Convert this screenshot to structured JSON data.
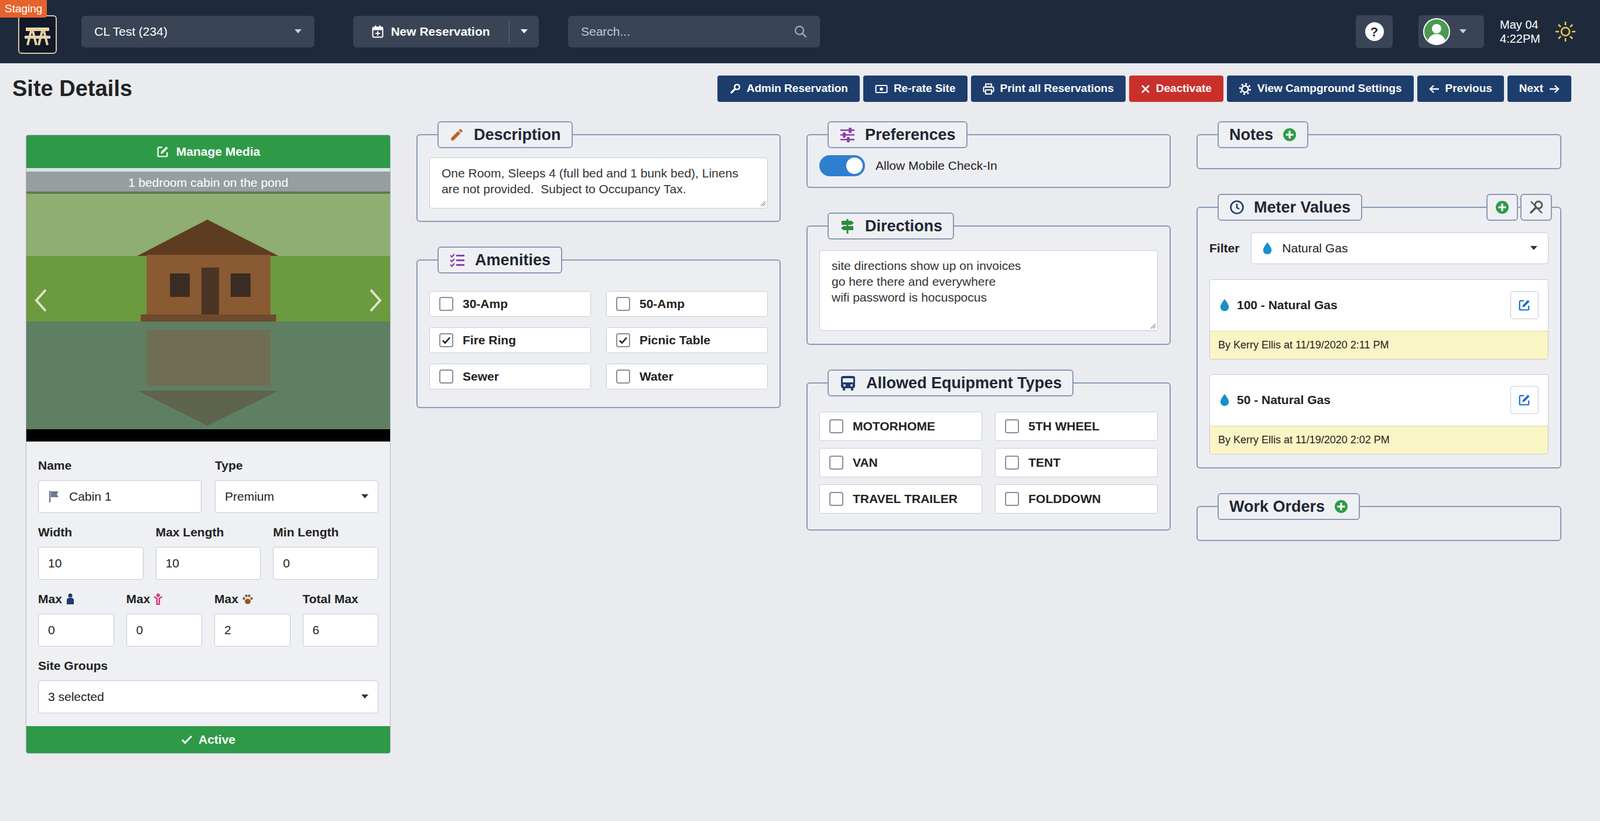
{
  "environment": "Staging",
  "topbar": {
    "campground": "CL Test (234)",
    "new_reservation": "New Reservation",
    "search": {
      "placeholder": "Search..."
    },
    "help": "?",
    "date": "May 04",
    "time": "4:22PM"
  },
  "page": {
    "title": "Site Details"
  },
  "actions": [
    {
      "label": "Admin Reservation",
      "kind": "primary"
    },
    {
      "label": "Re-rate Site",
      "kind": "primary"
    },
    {
      "label": "Print all Reservations",
      "kind": "primary"
    },
    {
      "label": "Deactivate",
      "kind": "danger"
    },
    {
      "label": "View Campground Settings",
      "kind": "primary"
    },
    {
      "label": "Previous",
      "kind": "primary"
    },
    {
      "label": "Next",
      "kind": "primary"
    }
  ],
  "media": {
    "header": "Manage Media",
    "caption": "1 bedroom cabin on the pond"
  },
  "site_form": {
    "name": {
      "label": "Name",
      "value": "Cabin 1",
      "kind": "text"
    },
    "type": {
      "label": "Type",
      "value": "Premium",
      "kind": "select"
    },
    "width": {
      "label": "Width",
      "value": "10",
      "kind": "text"
    },
    "max_length": {
      "label": "Max Length",
      "value": "10",
      "kind": "text"
    },
    "min_length": {
      "label": "Min Length",
      "value": "0",
      "kind": "text"
    },
    "max_adults": {
      "label": "Max",
      "value": "0",
      "kind": "text"
    },
    "max_children": {
      "label": "Max",
      "value": "0",
      "kind": "text"
    },
    "max_pets": {
      "label": "Max",
      "value": "2",
      "kind": "text"
    },
    "total_max": {
      "label": "Total Max",
      "value": "6",
      "kind": "text"
    },
    "site_groups": {
      "label": "Site Groups",
      "value": "3 selected",
      "kind": "select"
    }
  },
  "status": {
    "label": "Active",
    "active": true
  },
  "description": {
    "title": "Description",
    "text": "One Room, Sleeps 4 (full bed and 1 bunk bed), Linens are not provided.  Subject to Occupancy Tax."
  },
  "amenities": {
    "title": "Amenities",
    "items": [
      {
        "label": "30-Amp",
        "checked": false
      },
      {
        "label": "50-Amp",
        "checked": false
      },
      {
        "label": "Fire Ring",
        "checked": true
      },
      {
        "label": "Picnic Table",
        "checked": true
      },
      {
        "label": "Sewer",
        "checked": false
      },
      {
        "label": "Water",
        "checked": false
      }
    ]
  },
  "preferences": {
    "title": "Preferences",
    "items": [
      {
        "label": "Allow Mobile Check-In",
        "on": true
      }
    ]
  },
  "directions": {
    "title": "Directions",
    "text": "site directions show up on invoices\ngo here there and everywhere\nwifi password is hocuspocus"
  },
  "equipment": {
    "title": "Allowed Equipment Types",
    "items": [
      {
        "label": "MOTORHOME",
        "checked": false
      },
      {
        "label": "5TH WHEEL",
        "checked": false
      },
      {
        "label": "VAN",
        "checked": false
      },
      {
        "label": "TENT",
        "checked": false
      },
      {
        "label": "TRAVEL TRAILER",
        "checked": false
      },
      {
        "label": "FOLDDOWN",
        "checked": false
      }
    ]
  },
  "notes": {
    "title": "Notes"
  },
  "meters": {
    "title": "Meter Values",
    "filter": {
      "label": "Filter",
      "value": "Natural Gas"
    },
    "entries": [
      {
        "value": "100 - Natural Gas",
        "by": "By Kerry Ellis at 11/19/2020 2:11 PM"
      },
      {
        "value": "50 - Natural Gas",
        "by": "By Kerry Ellis at 11/19/2020 2:02 PM"
      }
    ]
  },
  "work_orders": {
    "title": "Work Orders"
  }
}
